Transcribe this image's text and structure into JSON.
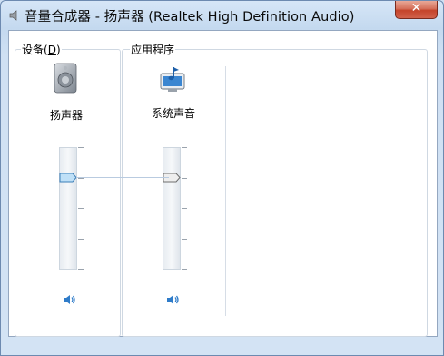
{
  "window": {
    "title": "音量合成器 - 扬声器 (Realtek High Definition Audio)",
    "close_label": "✕"
  },
  "devices_group": {
    "label_prefix": "设备(",
    "label_access_key": "D",
    "label_suffix": ")",
    "device_name": "扬声器",
    "volume_level": 0.75
  },
  "apps_group": {
    "label": "应用程序",
    "app_name": "系统声音",
    "volume_level": 0.75
  },
  "colors": {
    "accent": "#2f7cc9",
    "window_frame": "#cfe0f3",
    "close_button": "#c4432a"
  }
}
